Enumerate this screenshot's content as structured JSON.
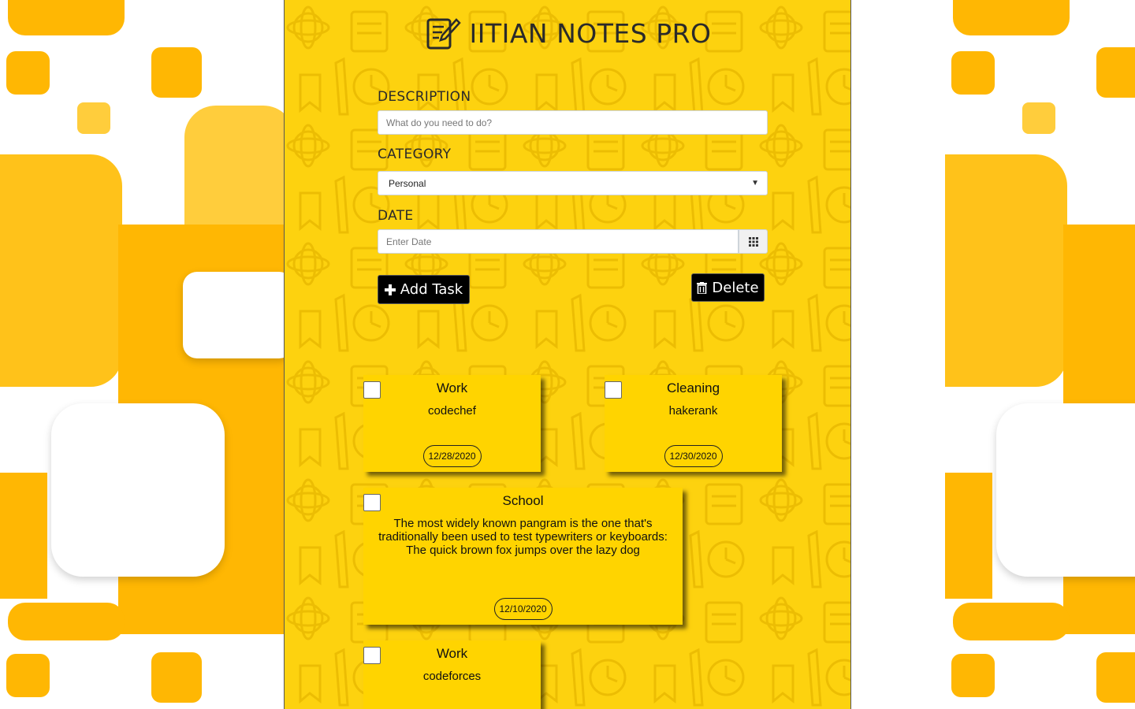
{
  "app": {
    "title": "IITIAN NOTES PRO"
  },
  "form": {
    "description_label": "DESCRIPTION",
    "description_placeholder": "What do you need to do?",
    "category_label": "CATEGORY",
    "category_selected": "Personal",
    "date_label": "DATE",
    "date_placeholder": "Enter Date"
  },
  "buttons": {
    "add_task": "Add Task",
    "delete": "Delete"
  },
  "tasks": [
    {
      "category": "Work",
      "description": "codechef",
      "date": "12/28/2020",
      "checked": false
    },
    {
      "category": "Cleaning",
      "description": "hakerank",
      "date": "12/30/2020",
      "checked": false
    },
    {
      "category": "School",
      "description": "The most widely known pangram is the one that's traditionally been used to test typewriters or keyboards: The quick brown fox jumps over the lazy dog",
      "date": "12/10/2020",
      "checked": false
    },
    {
      "category": "Work",
      "description": "codeforces",
      "date": "",
      "checked": false
    }
  ],
  "colors": {
    "panel_bg": "#fdd20f",
    "card_bg": "#ffd400",
    "button_bg": "#000000",
    "side_accent": "#ffb703"
  },
  "icons": {
    "header": "notepad-pencil-icon",
    "add": "plus-icon",
    "delete": "trash-icon",
    "date": "calendar-grid-icon",
    "select": "chevron-down-icon"
  }
}
